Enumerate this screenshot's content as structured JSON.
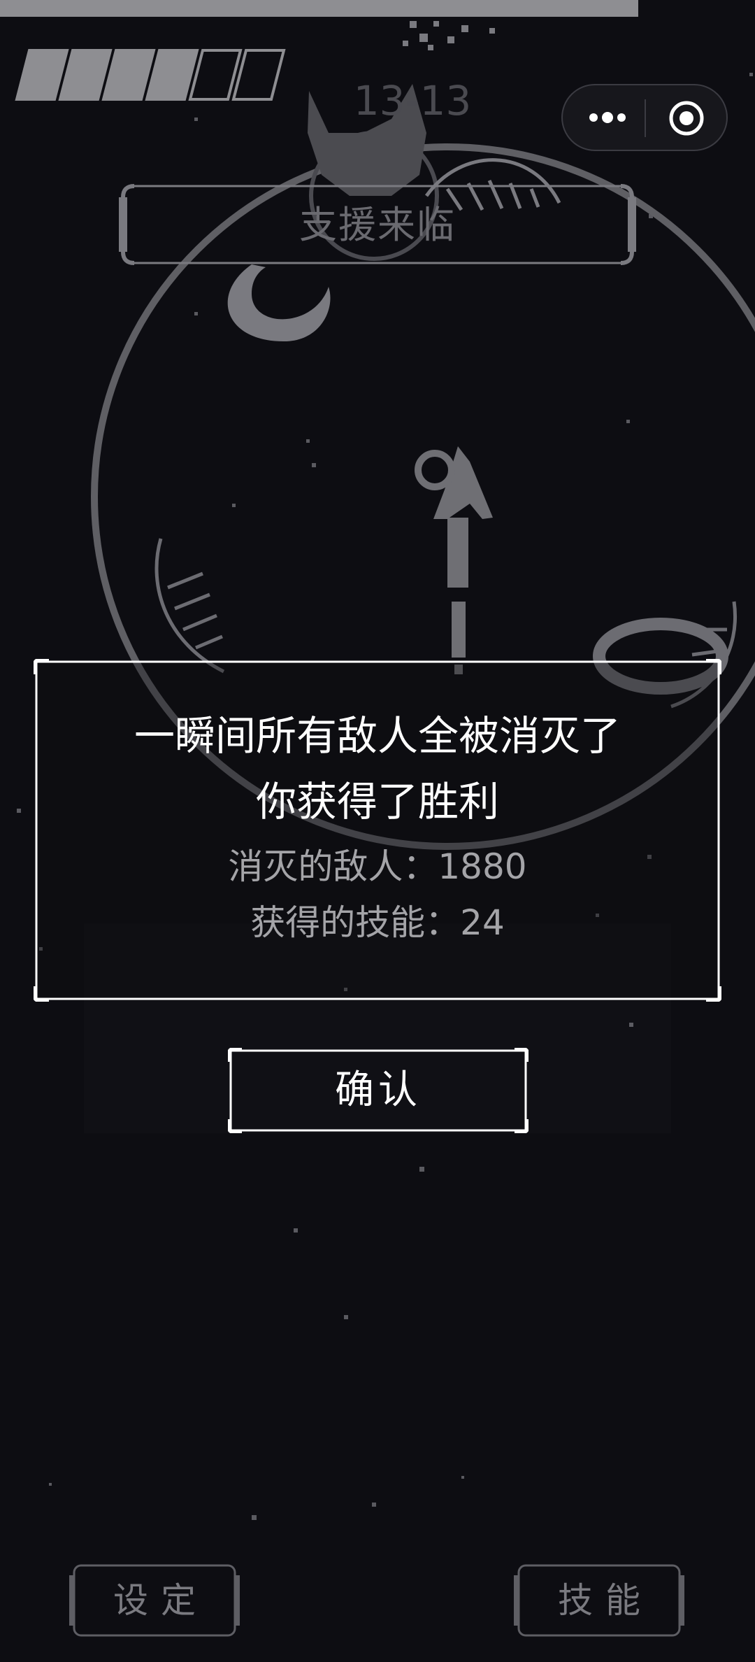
{
  "hud": {
    "health_segments_total": 6,
    "health_segments_filled": 4,
    "level_label": "13-13",
    "banner_text": "支援来临"
  },
  "capsule": {
    "more_icon": "more-dots-icon",
    "target_icon": "target-circle-icon"
  },
  "dialog": {
    "line1": "一瞬间所有敌人全被消灭了",
    "line2": "你获得了胜利",
    "enemies_label": "消灭的敌人：1880",
    "skills_label": "获得的技能：24"
  },
  "buttons": {
    "confirm": "确认",
    "settings": "设定",
    "skills": "技能"
  },
  "colors": {
    "background": "#0d0d12",
    "frame_white": "#ffffff",
    "frame_gray": "#8e8e92",
    "text_muted": "#a4a4a8"
  }
}
